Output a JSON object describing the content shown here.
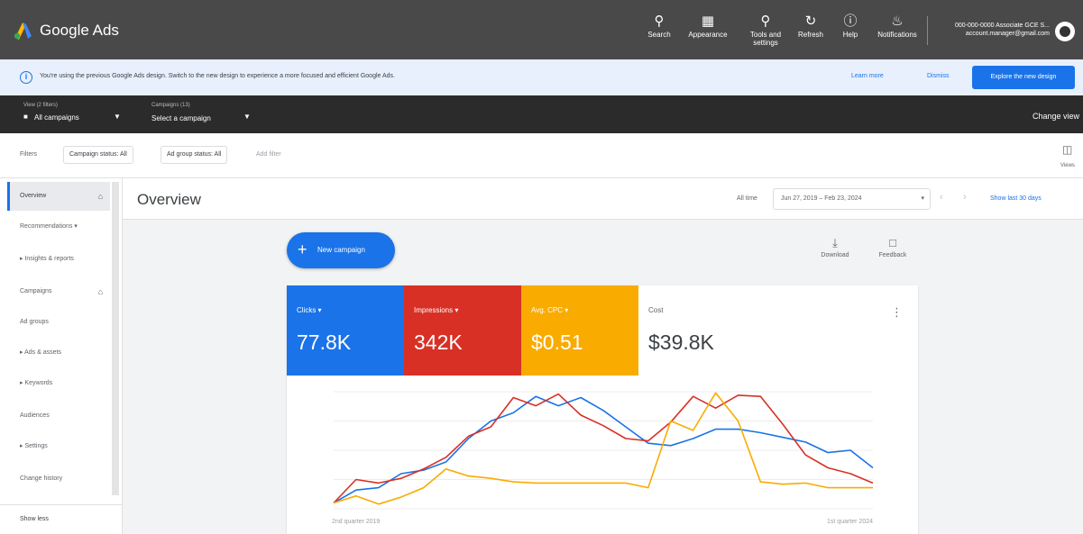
{
  "header": {
    "brand": "Google Ads",
    "tools": [
      {
        "label": "Search",
        "icon": "search-icon"
      },
      {
        "label": "Appearance",
        "icon": "appearance-icon"
      },
      {
        "label": "Tools and settings",
        "icon": "wrench-icon"
      },
      {
        "label": "Refresh",
        "icon": "refresh-icon"
      },
      {
        "label": "Help",
        "icon": "help-icon"
      },
      {
        "label": "Notifications",
        "icon": "bell-icon"
      }
    ],
    "account_line1": "000-000-0000 Associate GCE S...",
    "account_line2": "account.manager@gmail.com"
  },
  "banner": {
    "message": "You're using the previous Google Ads design. Switch to the new design to experience a more focused and efficient Google Ads.",
    "learn_more": "Learn more",
    "dismiss": "Dismiss",
    "explore": "Explore the new design"
  },
  "scope": {
    "view_label": "View (2 filters)",
    "view_value": "All campaigns",
    "campaign_label": "Campaigns (13)",
    "campaign_value": "Select a campaign",
    "change_view": "Change view"
  },
  "filters": {
    "label": "Filters",
    "chips": [
      "Campaign status: All",
      "Ad group status: All"
    ],
    "add": "Add filter",
    "views": "Views"
  },
  "sidebar": {
    "items": [
      {
        "label": "Overview",
        "active": true,
        "lock": true
      },
      {
        "label": "Recommendations ▾",
        "active": false,
        "lock": false
      },
      {
        "label": "▸ Insights & reports",
        "active": false,
        "lock": false
      },
      {
        "label": "Campaigns",
        "active": false,
        "lock": true
      },
      {
        "label": "Ad groups",
        "active": false,
        "lock": false
      },
      {
        "label": "▸ Ads & assets",
        "active": false,
        "lock": false
      },
      {
        "label": "▸ Keywords",
        "active": false,
        "lock": false
      },
      {
        "label": "Audiences",
        "active": false,
        "lock": false
      },
      {
        "label": "▸ Settings",
        "active": false,
        "lock": false
      },
      {
        "label": "Change history",
        "active": false,
        "lock": false
      }
    ],
    "bottom": "Show less"
  },
  "content": {
    "title": "Overview",
    "all_time": "All time",
    "date_range": "Jun 27, 2019 – Feb 23, 2024",
    "show_last": "Show last 30 days"
  },
  "actions": {
    "new_campaign": "New campaign",
    "download": "Download",
    "feedback": "Feedback"
  },
  "metrics": [
    {
      "label": "Clicks ▾",
      "value": "77.8K",
      "color": "#1a73e8"
    },
    {
      "label": "Impressions ▾",
      "value": "342K",
      "color": "#d93025"
    },
    {
      "label": "Avg. CPC ▾",
      "value": "$0.51",
      "color": "#f9ab00"
    },
    {
      "label": "Cost",
      "value": "$39.8K",
      "color": "#ffffff"
    }
  ],
  "chart_data": {
    "type": "line",
    "x_start_label": "2nd quarter 2019",
    "x_end_label": "1st quarter 2024",
    "ylim": [
      0,
      100
    ],
    "grid": true,
    "series": [
      {
        "color": "#1a73e8",
        "values": [
          5,
          16,
          18,
          30,
          33,
          40,
          60,
          75,
          82,
          96,
          88,
          95,
          84,
          70,
          56,
          54,
          60,
          68,
          68,
          65,
          61,
          57,
          48,
          50,
          35
        ]
      },
      {
        "color": "#d93025",
        "values": [
          5,
          25,
          22,
          26,
          34,
          44,
          62,
          70,
          95,
          88,
          98,
          80,
          71,
          60,
          58,
          74,
          96,
          86,
          97,
          96,
          72,
          46,
          35,
          30,
          22
        ]
      },
      {
        "color": "#f9ab00",
        "values": [
          5,
          11,
          4,
          10,
          18,
          34,
          28,
          26,
          23,
          22,
          22,
          22,
          22,
          22,
          18,
          75,
          67,
          99,
          75,
          23,
          21,
          22,
          18,
          18,
          18
        ]
      }
    ]
  }
}
